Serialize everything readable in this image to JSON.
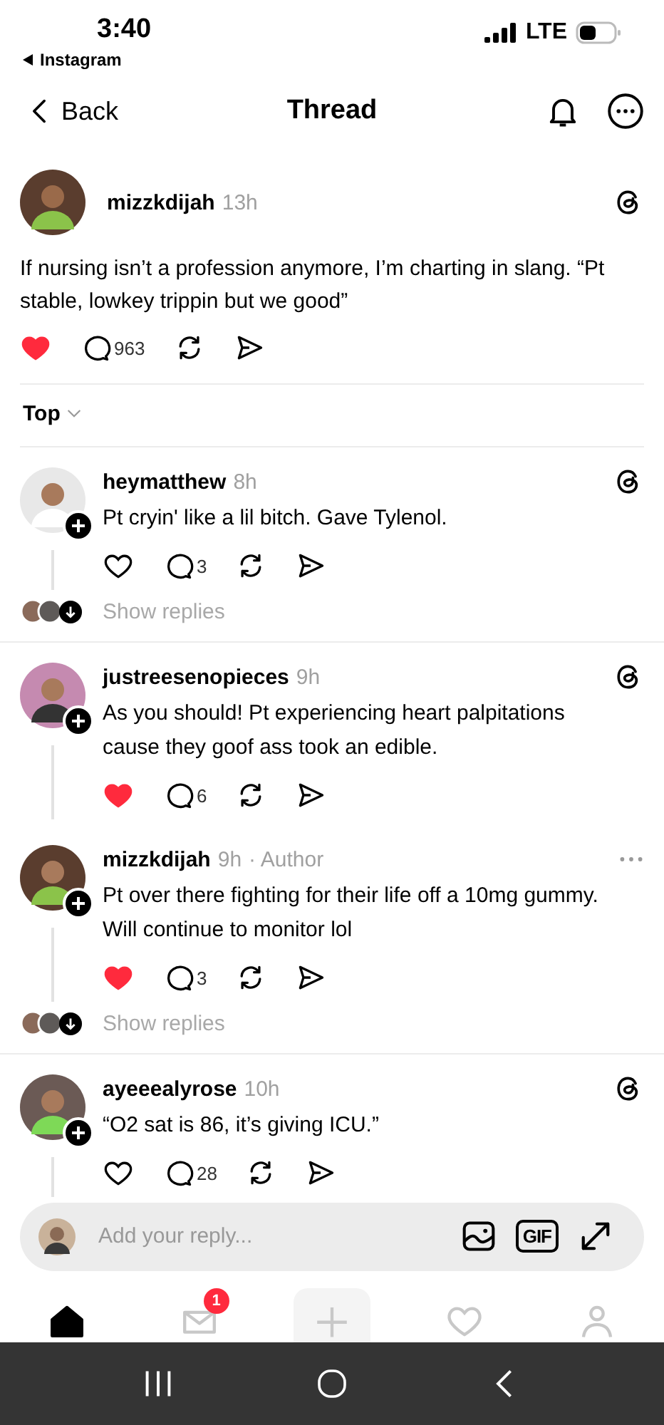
{
  "status_bar": {
    "time": "3:40",
    "back_app": "Instagram",
    "network": "LTE"
  },
  "header": {
    "back": "Back",
    "title": "Thread"
  },
  "post": {
    "username": "mizzkdijah",
    "time": "13h",
    "text": "If nursing isn’t a profession anymore, I’m charting in slang. “Pt stable, lowkey trippin but we good”",
    "liked": true,
    "replies": "963"
  },
  "sort": {
    "label": "Top"
  },
  "replies": [
    {
      "username": "heymatthew",
      "time": "8h",
      "kind": "threads",
      "text": "Pt cryin' like a lil bitch. Gave Tylenol.",
      "liked": false,
      "replies": "3",
      "show_replies": "Show replies"
    },
    {
      "username": "justreesenopieces",
      "time": "9h",
      "kind": "threads",
      "text": "As you should! Pt experiencing heart palpitations cause they goof ass took an edible.",
      "liked": true,
      "replies": "6"
    },
    {
      "username": "mizzkdijah",
      "time": "9h",
      "author_tag": "· Author",
      "kind": "more",
      "text": "Pt over there fighting for their life off a 10mg gummy. Will continue to monitor lol",
      "liked": true,
      "replies": "3",
      "show_replies": "Show replies"
    },
    {
      "username": "ayeeealyrose",
      "time": "10h",
      "kind": "threads",
      "text": "“O2 sat is 86, it’s giving ICU.”",
      "liked": false,
      "replies": "28"
    }
  ],
  "composer": {
    "placeholder": "Add your reply...",
    "gif_label": "GIF"
  },
  "bottom_nav": [
    {
      "kind": "home",
      "selected": true
    },
    {
      "kind": "messages",
      "selected": false,
      "badge": "1"
    },
    {
      "kind": "create",
      "selected": false
    },
    {
      "kind": "activity",
      "selected": false
    },
    {
      "kind": "profile",
      "selected": false
    }
  ]
}
